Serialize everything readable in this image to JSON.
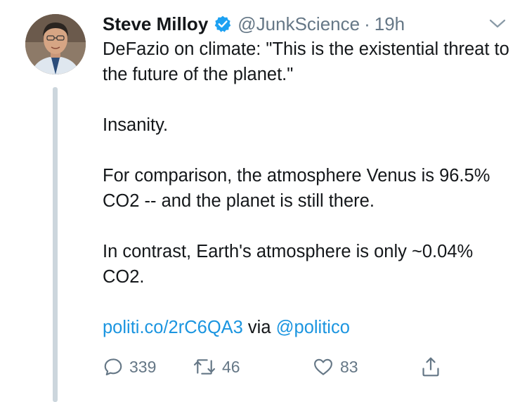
{
  "author": {
    "name": "Steve Milloy",
    "handle": "@JunkScience",
    "separator": "·",
    "time": "19h",
    "verified": true,
    "avatar_icon": "profile-photo"
  },
  "tweet": {
    "paragraphs": [
      "DeFazio on climate: \"This is the existential threat to the future of the planet.\"",
      "Insanity.",
      "For comparison, the atmosphere Venus is 96.5% CO2 -- and the planet is still there.",
      "In contrast, Earth's atmosphere is only ~0.04% CO2."
    ],
    "link_text": "politi.co/2rC6QA3",
    "via_text": " via ",
    "mention": "@politico"
  },
  "actions": {
    "reply_count": "339",
    "retweet_count": "46",
    "like_count": "83",
    "icons": [
      "reply-icon",
      "retweet-icon",
      "like-icon",
      "share-icon"
    ]
  },
  "colors": {
    "link": "#1b95e0",
    "verified": "#1da1f2",
    "muted": "#657786",
    "text": "#14171a",
    "thread_line": "#ccd6dd"
  }
}
